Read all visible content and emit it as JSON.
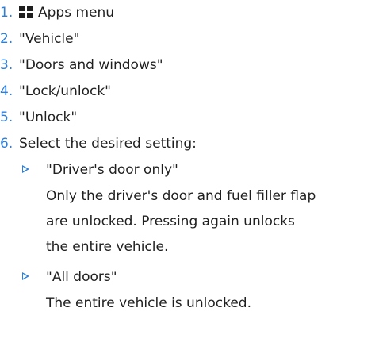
{
  "steps": [
    {
      "number": "1.",
      "label": "Apps menu",
      "icon": "apps-grid-icon"
    },
    {
      "number": "2.",
      "label": "\"Vehicle\""
    },
    {
      "number": "3.",
      "label": "\"Doors and windows\""
    },
    {
      "number": "4.",
      "label": "\"Lock/unlock\""
    },
    {
      "number": "5.",
      "label": "\"Unlock\""
    },
    {
      "number": "6.",
      "label": "Select the desired setting:"
    }
  ],
  "options": [
    {
      "label": "\"Driver's door only\"",
      "description_lines": [
        "Only the driver's door and fuel filler flap",
        "are unlocked. Pressing again unlocks",
        "the entire vehicle."
      ]
    },
    {
      "label": "\"All doors\"",
      "description_lines": [
        "The entire vehicle is unlocked."
      ]
    }
  ],
  "colors": {
    "accent": "#2e7fd9",
    "text": "#1f1f1f"
  }
}
